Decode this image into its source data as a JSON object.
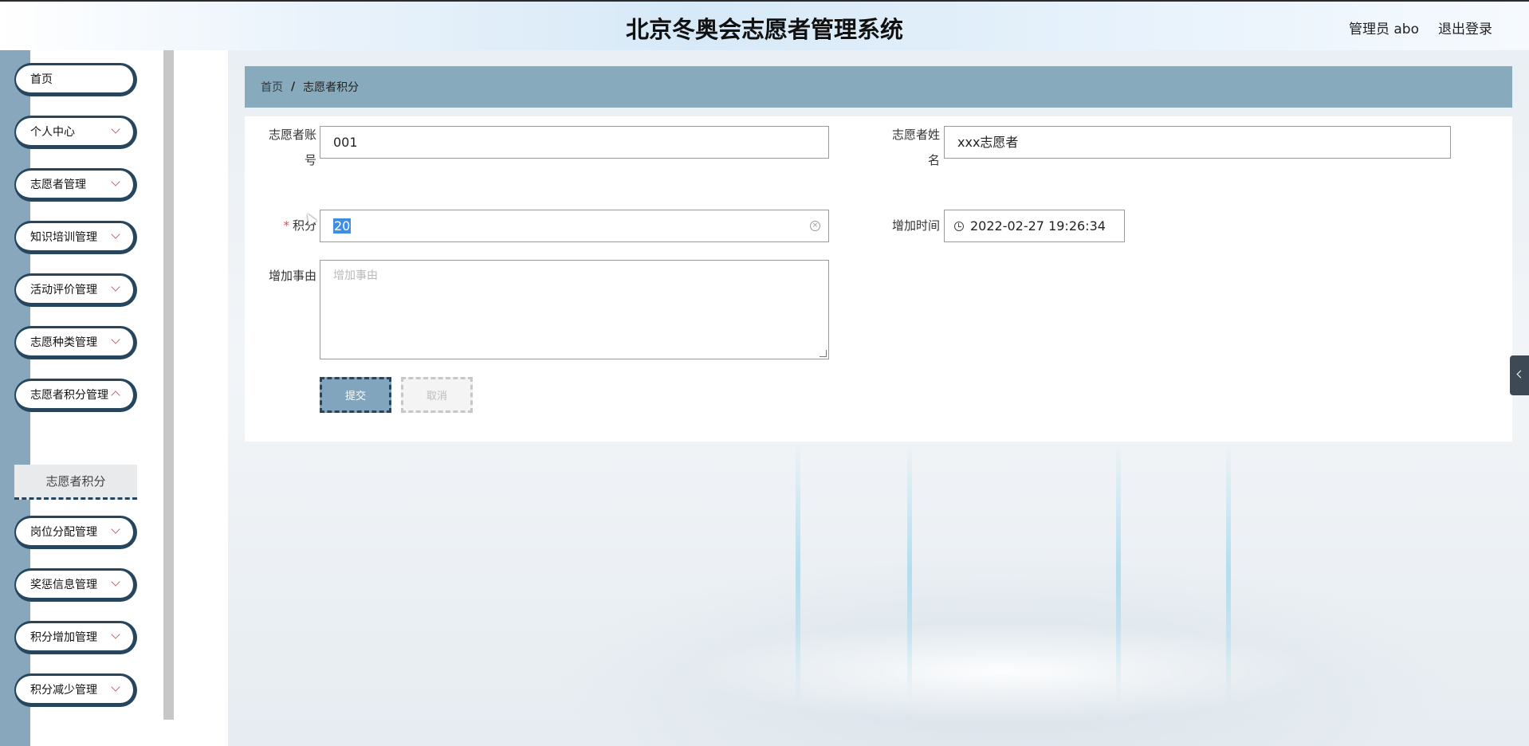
{
  "header": {
    "title": "北京冬奥会志愿者管理系统",
    "user": "管理员 abo",
    "logout": "退出登录"
  },
  "sidebar": {
    "items": [
      {
        "label": "首页",
        "expandable": false
      },
      {
        "label": "个人中心",
        "expandable": true
      },
      {
        "label": "志愿者管理",
        "expandable": true
      },
      {
        "label": "知识培训管理",
        "expandable": true
      },
      {
        "label": "活动评价管理",
        "expandable": true
      },
      {
        "label": "志愿种类管理",
        "expandable": true
      },
      {
        "label": "志愿者积分管理",
        "expandable": true
      },
      {
        "label": "岗位分配管理",
        "expandable": true
      },
      {
        "label": "奖惩信息管理",
        "expandable": true
      },
      {
        "label": "积分增加管理",
        "expandable": true
      },
      {
        "label": "积分减少管理",
        "expandable": true
      }
    ],
    "active_sub": "志愿者积分"
  },
  "breadcrumb": {
    "home": "首页",
    "separator": "/",
    "current": "志愿者积分"
  },
  "form": {
    "account_label_1": "志愿者账",
    "account_label_2": "号",
    "account_value": "001",
    "name_label_1": "志愿者姓",
    "name_label_2": "名",
    "name_value": "xxx志愿者",
    "required_mark": "*",
    "points_label": "积分",
    "points_value": "20",
    "time_label": "增加时间",
    "time_value": "2022-02-27 19:26:34",
    "reason_label": "增加事由",
    "reason_placeholder": "增加事由",
    "submit": "提交",
    "cancel": "取消"
  },
  "colors": {
    "accent": "#88aabd",
    "sidebar_border": "#27465e",
    "submit_bg": "#80a5bd"
  }
}
